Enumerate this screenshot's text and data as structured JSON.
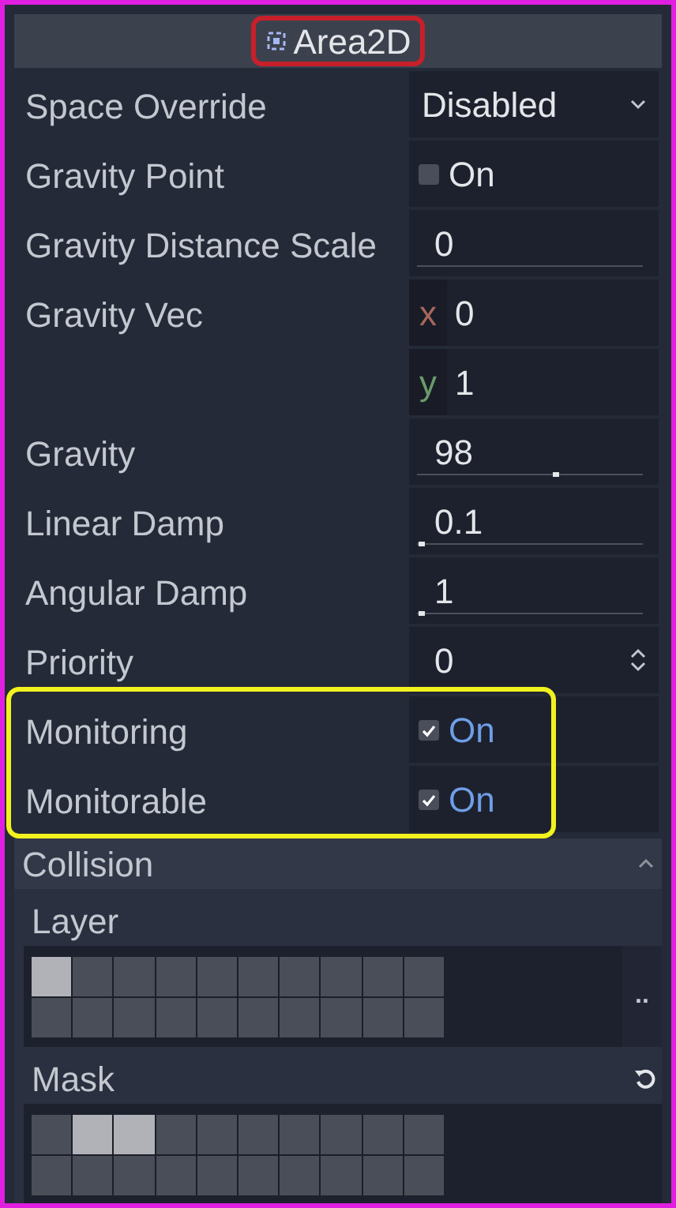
{
  "header": {
    "title": "Area2D",
    "highlighted": true
  },
  "properties": [
    {
      "kind": "dropdown",
      "label": "Space Override",
      "value": "Disabled",
      "highlighted": false
    },
    {
      "kind": "checkbox",
      "label": "Gravity Point",
      "value": "On",
      "checked": false,
      "highlighted": false
    },
    {
      "kind": "slider",
      "label": "Gravity Distance Scale",
      "value": "0",
      "highlighted": false
    },
    {
      "kind": "vector",
      "label": "Gravity Vec",
      "components": [
        {
          "axis": "x",
          "value": "0"
        },
        {
          "axis": "y",
          "value": "1"
        }
      ],
      "highlighted": false
    },
    {
      "kind": "slider",
      "label": "Gravity",
      "value": "98",
      "level": 0.6,
      "highlighted": false
    },
    {
      "kind": "slider",
      "label": "Linear Damp",
      "value": "0.1",
      "level": 0.01,
      "highlighted": false
    },
    {
      "kind": "slider",
      "label": "Angular Damp",
      "value": "1",
      "level": 0.01,
      "highlighted": false
    },
    {
      "kind": "spinbox",
      "label": "Priority",
      "value": "0",
      "highlighted": false
    },
    {
      "kind": "checkbox",
      "label": "Monitoring",
      "value": "On",
      "checked": true,
      "highlighted": true
    },
    {
      "kind": "checkbox",
      "label": "Monitorable",
      "value": "On",
      "checked": true,
      "highlighted": true
    }
  ],
  "section": {
    "title": "Collision",
    "expanded": true,
    "layers": [
      {
        "label": "Layer",
        "action": "..",
        "revertable": false,
        "bits": [
          {
            "checked": true
          },
          {
            "checked": false
          },
          {
            "checked": false
          },
          {
            "checked": false
          },
          {
            "checked": false
          },
          {
            "checked": false
          },
          {
            "checked": false
          },
          {
            "checked": false
          },
          {
            "checked": false
          },
          {
            "checked": false
          },
          {
            "checked": false
          },
          {
            "checked": false
          },
          {
            "checked": false
          },
          {
            "checked": false
          },
          {
            "checked": false
          },
          {
            "checked": false
          },
          {
            "checked": false
          },
          {
            "checked": false
          },
          {
            "checked": false
          },
          {
            "checked": false
          }
        ]
      },
      {
        "label": "Mask",
        "revertable": true,
        "bits": [
          {
            "checked": false
          },
          {
            "checked": true
          },
          {
            "checked": true
          },
          {
            "checked": false
          },
          {
            "checked": false
          },
          {
            "checked": false
          },
          {
            "checked": false
          },
          {
            "checked": false
          },
          {
            "checked": false
          },
          {
            "checked": false
          },
          {
            "checked": false
          },
          {
            "checked": false
          },
          {
            "checked": false
          },
          {
            "checked": false
          },
          {
            "checked": false
          },
          {
            "checked": false
          },
          {
            "checked": false
          },
          {
            "checked": false
          },
          {
            "checked": false
          },
          {
            "checked": false
          }
        ]
      }
    ]
  }
}
